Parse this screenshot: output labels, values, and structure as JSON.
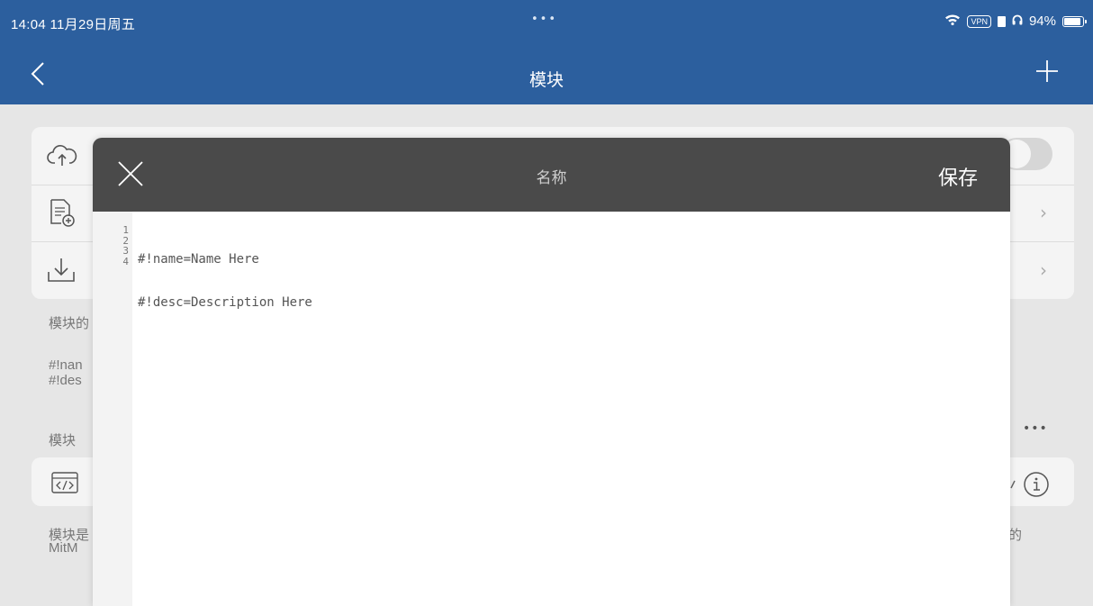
{
  "status_bar": {
    "time": "14:04  11月29日周五",
    "dots": "•••",
    "vpn": "VPN",
    "battery": "94%",
    "battery_level": 0.94
  },
  "nav": {
    "title": "模块"
  },
  "background": {
    "section_text": "模块的",
    "snippet_line1": "#!nan",
    "snippet_line2": "#!des",
    "section_header": "模块",
    "more": "•••",
    "footer_line1": "模块是",
    "footer_line2": "MitM",
    "footer_right": "的",
    "chevron": "›"
  },
  "modal": {
    "title": "名称",
    "save": "保存",
    "line_numbers": [
      "1",
      "2",
      "3",
      "4"
    ],
    "code_lines": [
      "#!name=Name Here",
      "#!desc=Description Here",
      "",
      ""
    ]
  },
  "colors": {
    "brand": "#2c5f9e",
    "modal_header": "#4a4a4a"
  }
}
